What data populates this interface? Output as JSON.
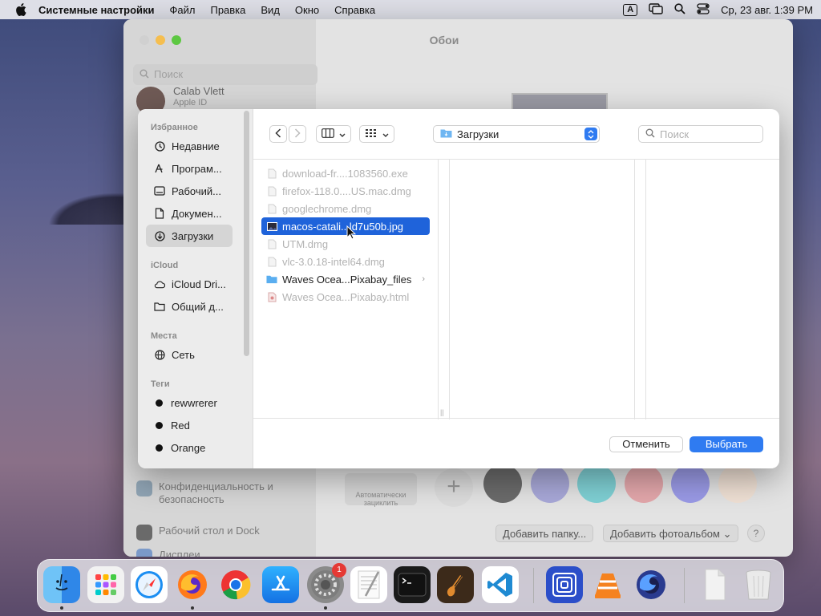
{
  "menubar": {
    "app_name": "Системные настройки",
    "items": [
      "Файл",
      "Правка",
      "Вид",
      "Окно",
      "Справка"
    ],
    "input_source": "A",
    "datetime": "Ср, 23 авг.  1:39 PM"
  },
  "settings": {
    "title": "Обои",
    "search_placeholder": "Поиск",
    "user_name": "Calab Vlett",
    "user_sub": "Apple ID",
    "rows": [
      "Конфиденциальность и безопасность",
      "Рабочий стол и Dock",
      "Дисплеи"
    ],
    "auto_label": "Автоматически зациклить",
    "add_folder": "Добавить папку...",
    "add_album": "Добавить фотоальбом",
    "help": "?",
    "swatches": [
      "#6b6b6b",
      "#a8a8d8",
      "#7fd0d4",
      "#e3a7ab",
      "#9a9ae6",
      "#efe0d4"
    ]
  },
  "dialog": {
    "sidebar": {
      "favorites_header": "Избранное",
      "favorites": [
        {
          "label": "Недавние",
          "icon": "clock-icon"
        },
        {
          "label": "Програм...",
          "icon": "apps-icon"
        },
        {
          "label": "Рабочий...",
          "icon": "desktop-icon"
        },
        {
          "label": "Докумен...",
          "icon": "document-icon"
        },
        {
          "label": "Загрузки",
          "icon": "download-icon"
        }
      ],
      "icloud_header": "iCloud",
      "icloud": [
        {
          "label": "iCloud Dri...",
          "icon": "cloud-icon"
        },
        {
          "label": "Общий д...",
          "icon": "shared-folder-icon"
        }
      ],
      "places_header": "Места",
      "places": [
        {
          "label": "Сеть",
          "icon": "globe-icon"
        }
      ],
      "tags_header": "Теги",
      "tags": [
        "rewwrerer",
        "Red",
        "Orange"
      ]
    },
    "location": "Загрузки",
    "search_placeholder": "Поиск",
    "files": [
      {
        "name": "download-fr....1083560.exe",
        "type": "file"
      },
      {
        "name": "firefox-118.0....US.mac.dmg",
        "type": "file"
      },
      {
        "name": "googlechrome.dmg",
        "type": "file"
      },
      {
        "name": "macos-catali...ld7u50b.jpg",
        "type": "image",
        "selected": true
      },
      {
        "name": "UTM.dmg",
        "type": "file"
      },
      {
        "name": "vlc-3.0.18-intel64.dmg",
        "type": "file"
      },
      {
        "name": "Waves Ocea...Pixabay_files",
        "type": "folder"
      },
      {
        "name": "Waves Ocea...Pixabay.html",
        "type": "html"
      }
    ],
    "cancel_label": "Отменить",
    "choose_label": "Выбрать"
  },
  "dock": {
    "apps": [
      "Finder",
      "Launchpad",
      "Safari",
      "Firefox",
      "Chrome",
      "App Store",
      "System Settings",
      "TextEdit",
      "Terminal",
      "GarageBand",
      "VS Code",
      "UTM",
      "VLC",
      "Firefox Developer",
      "Documents",
      "Trash"
    ],
    "settings_badge": "1"
  }
}
